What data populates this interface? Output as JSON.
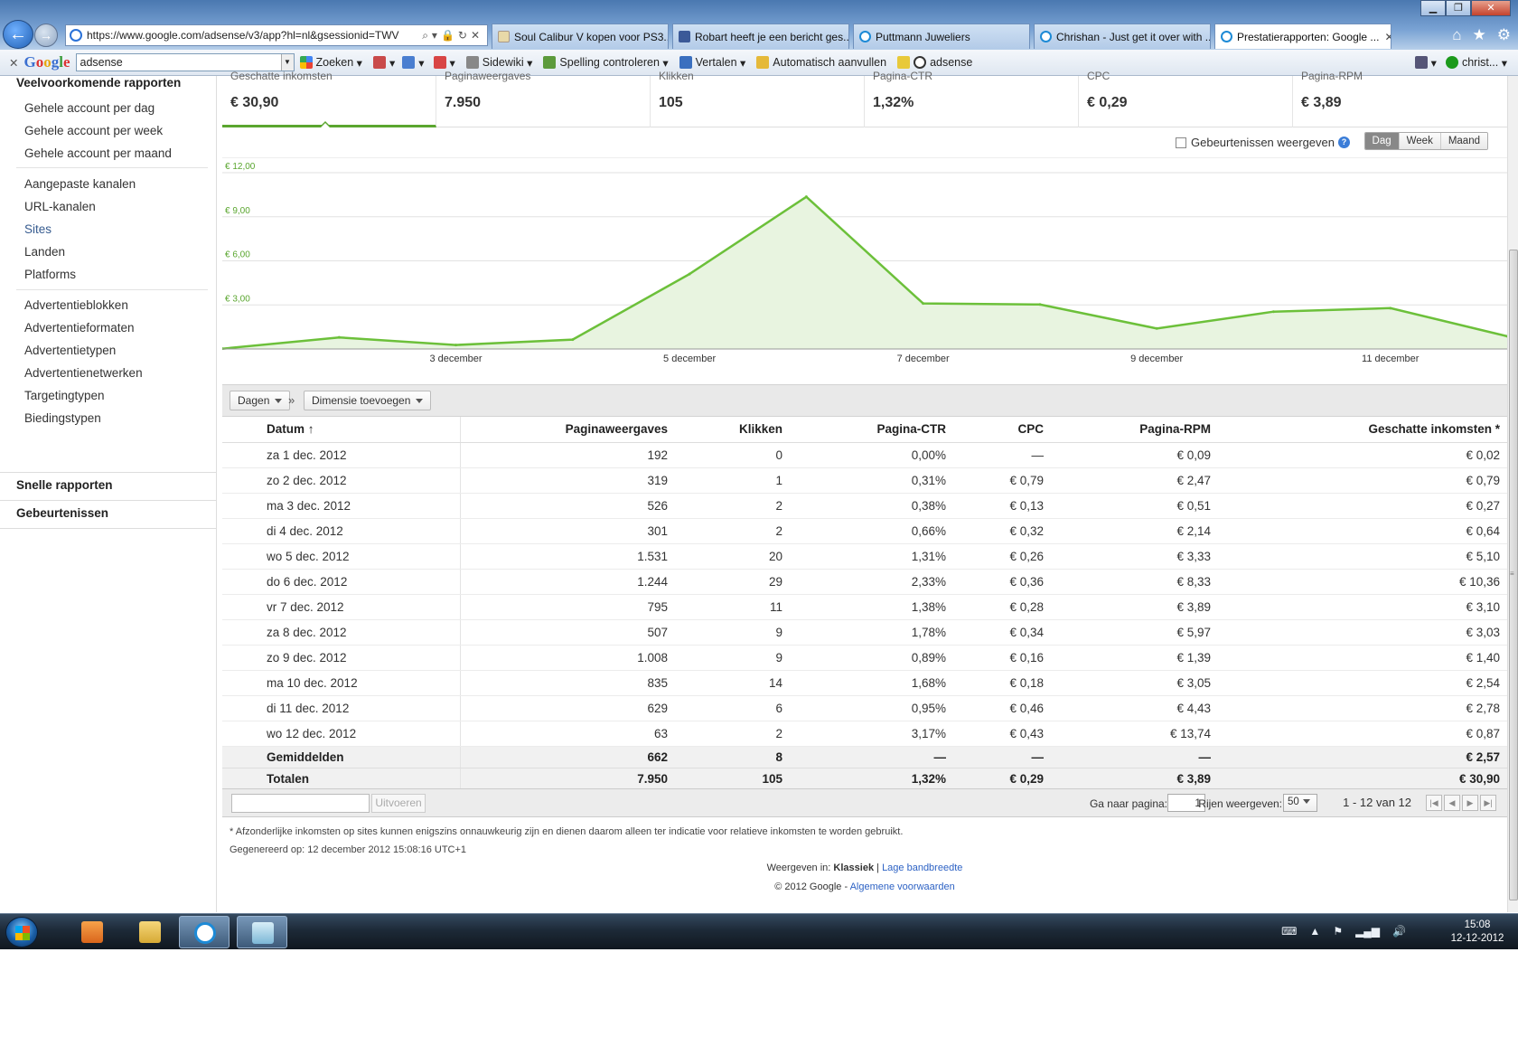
{
  "browser": {
    "url": "https://www.google.com/adsense/v3/app?hl=nl&gsessionid=TWV",
    "tabs": [
      {
        "label": "Soul Calibur V kopen voor PS3...."
      },
      {
        "label": "Robart heeft je een bericht ges..."
      },
      {
        "label": "Puttmann Juweliers"
      },
      {
        "label": "Chrishan - Just get it over with ..."
      },
      {
        "label": "Prestatierapporten: Google ..."
      }
    ]
  },
  "toolbar": {
    "search_value": "adsense",
    "zoeken": "Zoeken",
    "sidewiki": "Sidewiki",
    "spelling": "Spelling controleren",
    "vertalen": "Vertalen",
    "autofill": "Automatisch aanvullen",
    "adsense": "adsense",
    "user": "christ..."
  },
  "sidebar": {
    "section_common": "Veelvoorkomende rapporten",
    "items": [
      {
        "label": "Gehele account per dag"
      },
      {
        "label": "Gehele account per week"
      },
      {
        "label": "Gehele account per maand"
      },
      {
        "label": "Aangepaste kanalen"
      },
      {
        "label": "URL-kanalen"
      },
      {
        "label": "Sites"
      },
      {
        "label": "Landen"
      },
      {
        "label": "Platforms"
      },
      {
        "label": "Advertentieblokken"
      },
      {
        "label": "Advertentieformaten"
      },
      {
        "label": "Advertentietypen"
      },
      {
        "label": "Advertentienetwerken"
      },
      {
        "label": "Targetingtypen"
      },
      {
        "label": "Biedingstypen"
      }
    ],
    "section_quick": "Snelle rapporten",
    "section_events": "Gebeurtenissen"
  },
  "kpis": [
    {
      "label": "Geschatte inkomsten",
      "value": "€ 30,90"
    },
    {
      "label": "Paginaweergaves",
      "value": "7.950"
    },
    {
      "label": "Klikken",
      "value": "105"
    },
    {
      "label": "Pagina-CTR",
      "value": "1,32%"
    },
    {
      "label": "CPC",
      "value": "€ 0,29"
    },
    {
      "label": "Pagina-RPM",
      "value": "€ 3,89"
    }
  ],
  "chart_controls": {
    "events_label": "Gebeurtenissen weergeven",
    "help": "?",
    "range": {
      "day": "Dag",
      "week": "Week",
      "month": "Maand",
      "selected": "Dag"
    }
  },
  "chart_data": {
    "type": "area",
    "x": [
      "1 dec",
      "2 dec",
      "3 dec",
      "4 dec",
      "5 dec",
      "6 dec",
      "7 dec",
      "8 dec",
      "9 dec",
      "10 dec",
      "11 dec",
      "12 dec"
    ],
    "series": [
      {
        "values": [
          0.02,
          0.79,
          0.27,
          0.64,
          5.1,
          10.36,
          3.1,
          3.03,
          1.4,
          2.54,
          2.78,
          0.87
        ],
        "color": "#6cc03a"
      }
    ],
    "ylim": [
      0,
      12
    ],
    "yticks": [
      "€ 3,00",
      "€ 6,00",
      "€ 9,00",
      "€ 12,00"
    ],
    "xtick_labels": [
      "3 december",
      "5 december",
      "7 december",
      "9 december",
      "11 december"
    ],
    "grid": true
  },
  "dimension_bar": {
    "days": "Dagen",
    "sep": "»",
    "add_dimension": "Dimensie toevoegen"
  },
  "table": {
    "headers": [
      "Datum",
      "Paginaweergaves",
      "Klikken",
      "Pagina-CTR",
      "CPC",
      "Pagina-RPM",
      "Geschatte inkomsten *"
    ],
    "sort_indicator": "↑",
    "rows": [
      [
        "za 1 dec. 2012",
        "192",
        "0",
        "0,00%",
        "—",
        "€ 0,09",
        "€ 0,02"
      ],
      [
        "zo 2 dec. 2012",
        "319",
        "1",
        "0,31%",
        "€ 0,79",
        "€ 2,47",
        "€ 0,79"
      ],
      [
        "ma 3 dec. 2012",
        "526",
        "2",
        "0,38%",
        "€ 0,13",
        "€ 0,51",
        "€ 0,27"
      ],
      [
        "di 4 dec. 2012",
        "301",
        "2",
        "0,66%",
        "€ 0,32",
        "€ 2,14",
        "€ 0,64"
      ],
      [
        "wo 5 dec. 2012",
        "1.531",
        "20",
        "1,31%",
        "€ 0,26",
        "€ 3,33",
        "€ 5,10"
      ],
      [
        "do 6 dec. 2012",
        "1.244",
        "29",
        "2,33%",
        "€ 0,36",
        "€ 8,33",
        "€ 10,36"
      ],
      [
        "vr 7 dec. 2012",
        "795",
        "11",
        "1,38%",
        "€ 0,28",
        "€ 3,89",
        "€ 3,10"
      ],
      [
        "za 8 dec. 2012",
        "507",
        "9",
        "1,78%",
        "€ 0,34",
        "€ 5,97",
        "€ 3,03"
      ],
      [
        "zo 9 dec. 2012",
        "1.008",
        "9",
        "0,89%",
        "€ 0,16",
        "€ 1,39",
        "€ 1,40"
      ],
      [
        "ma 10 dec. 2012",
        "835",
        "14",
        "1,68%",
        "€ 0,18",
        "€ 3,05",
        "€ 2,54"
      ],
      [
        "di 11 dec. 2012",
        "629",
        "6",
        "0,95%",
        "€ 0,46",
        "€ 4,43",
        "€ 2,78"
      ],
      [
        "wo 12 dec. 2012",
        "63",
        "2",
        "3,17%",
        "€ 0,43",
        "€ 13,74",
        "€ 0,87"
      ]
    ],
    "averages": [
      "Gemiddelden",
      "662",
      "8",
      "—",
      "—",
      "—",
      "€ 2,57"
    ],
    "totals": [
      "Totalen",
      "7.950",
      "105",
      "1,32%",
      "€ 0,29",
      "€ 3,89",
      "€ 30,90"
    ]
  },
  "pager": {
    "run": "Uitvoeren",
    "goto_label": "Ga naar pagina:",
    "goto_value": "1",
    "rows_label": "Rijen weergeven:",
    "rows_value": "50",
    "range_text": "1 - 12 van 12"
  },
  "footer": {
    "footnote": "* Afzonderlijke inkomsten op sites kunnen enigszins onnauwkeurig zijn en dienen daarom alleen ter indicatie voor relatieve inkomsten te worden gebruikt.",
    "generated": "Gegenereerd op: 12 december 2012 15:08:16 UTC+1",
    "view_in": "Weergeven in:",
    "classic": "Klassiek",
    "low_bandwidth": "Lage bandbreedte",
    "copyright": "© 2012 Google -",
    "terms": "Algemene voorwaarden"
  },
  "taskbar": {
    "time": "15:08",
    "date": "12-12-2012"
  }
}
